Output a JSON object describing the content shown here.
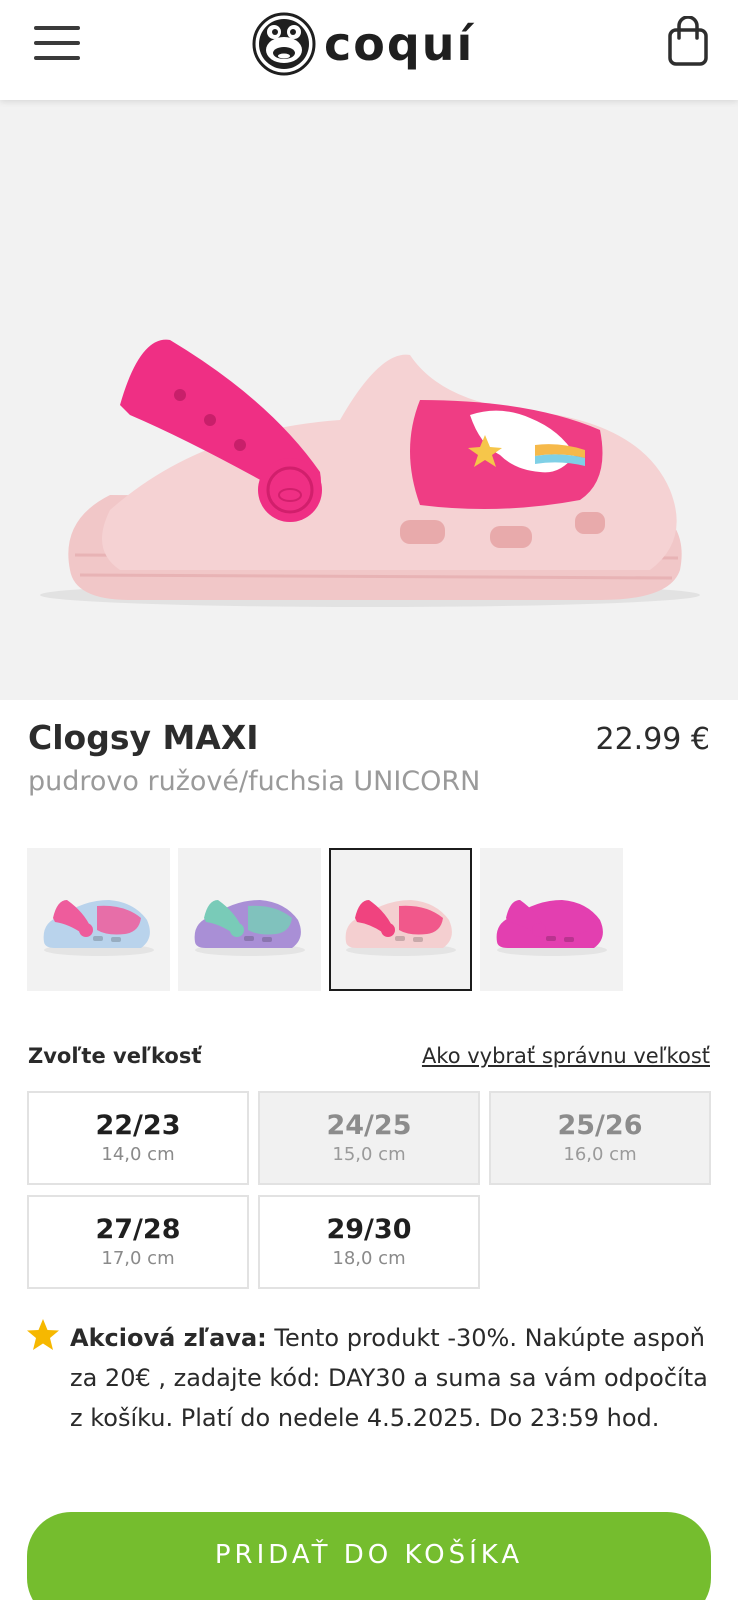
{
  "header": {
    "brand": "coquí",
    "menu_icon": "hamburger-menu-icon",
    "cart_icon": "shopping-bag-icon"
  },
  "gallery": {
    "image_count": 5,
    "active_index": 1
  },
  "product": {
    "name": "Clogsy MAXI",
    "price": "22.99 €",
    "color_name": "pudrovo ružové/fuchsia UNICORN"
  },
  "variants": [
    {
      "color": "#b9d3ec",
      "strap": "#ee5c9c",
      "selected": false
    },
    {
      "color": "#a98fd6",
      "strap": "#79cbb8",
      "selected": false
    },
    {
      "color": "#f4cfd0",
      "strap": "#f0437f",
      "selected": true
    },
    {
      "color": "#e33fb0",
      "strap": "#e33fb0",
      "selected": false
    }
  ],
  "size_section": {
    "label": "Zvoľte veľkosť",
    "guide_link": "Ako vybrať správnu veľkosť",
    "sizes": [
      {
        "size": "22/23",
        "cm": "14,0 cm",
        "available": true
      },
      {
        "size": "24/25",
        "cm": "15,0 cm",
        "available": false
      },
      {
        "size": "25/26",
        "cm": "16,0 cm",
        "available": false
      },
      {
        "size": "27/28",
        "cm": "17,0 cm",
        "available": true
      },
      {
        "size": "29/30",
        "cm": "18,0 cm",
        "available": true
      }
    ]
  },
  "promo": {
    "icon": "star-icon",
    "bold": "Akciová zľava:",
    "text": " Tento produkt -30%. Nakúpte aspoň za 20€ , zadajte kód: DAY30 a suma sa vám odpočíta z košíku. Platí do nedele 4.5.2025. Do 23:59 hod."
  },
  "cta": {
    "add_to_cart": "PRIDAŤ DO KOŠÍKA"
  },
  "colors": {
    "accent_green": "#75bd2e",
    "text_dark": "#2c2c2c",
    "text_muted": "#9a9a9a"
  }
}
